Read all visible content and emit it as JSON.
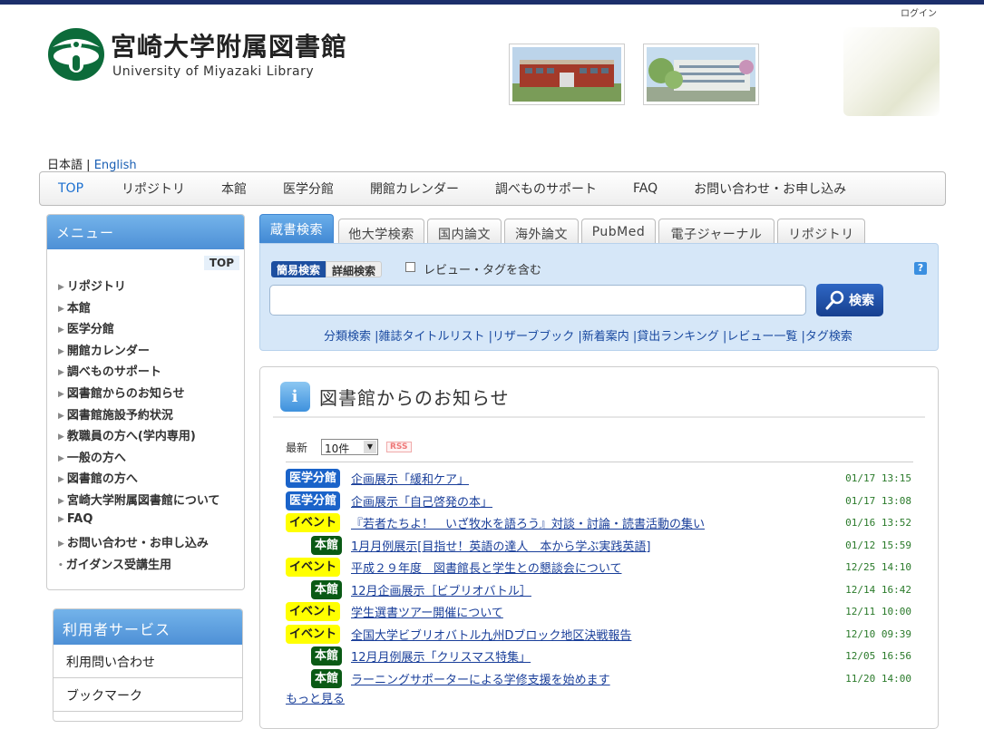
{
  "header": {
    "login": "ログイン",
    "title": "宮崎大学附属図書館",
    "subtitle": "University of Miyazaki Library"
  },
  "lang": {
    "current": "日本語",
    "separator": "|",
    "english": "English"
  },
  "gnav": [
    "TOP",
    "リポジトリ",
    "本館",
    "医学分館",
    "開館カレンダー",
    "調べものサポート",
    "FAQ",
    "お問い合わせ・お申し込み"
  ],
  "sidebar": {
    "title": "メニュー",
    "top_button": "TOP",
    "items": [
      "リポジトリ",
      "本館",
      "医学分館",
      "開館カレンダー",
      "調べものサポート",
      "図書館からのお知らせ",
      "図書館施設予約状況",
      "教職員の方へ(学内専用)",
      "一般の方へ",
      "図書館の方へ",
      "宮崎大学附属図書館について",
      "FAQ",
      "お問い合わせ・お申し込み",
      "ガイダンス受講生用"
    ]
  },
  "services": {
    "title": "利用者サービス",
    "items": [
      "利用問い合わせ",
      "ブックマーク"
    ]
  },
  "search": {
    "tabs": [
      "蔵書検索",
      "他大学検索",
      "国内論文",
      "海外論文",
      "PubMed",
      "電子ジャーナル",
      "リポジトリ"
    ],
    "active_tab": "蔵書検索",
    "mode_simple": "簡易検索",
    "mode_detail": "詳細検索",
    "review_tag_label": "レビュー・タグを含む",
    "help": "?",
    "button": "検索",
    "input_value": "",
    "links": "分類検索 |雑誌タイトルリスト |リザーブブック |新着案内 |貸出ランキング |レビュー一覧 |タグ検索"
  },
  "news": {
    "title": "図書館からのお知らせ",
    "latest_label": "最新",
    "count_selected": "10件",
    "rss": "RSS",
    "more": "もっと見る",
    "items": [
      {
        "tag": "医学分館",
        "type": "med",
        "title": "企画展示「緩和ケア」",
        "date": "01/17 13:15"
      },
      {
        "tag": "医学分館",
        "type": "med",
        "title": "企画展示「自己啓発の本」",
        "date": "01/17 13:08"
      },
      {
        "tag": "イベント",
        "type": "event",
        "title": "『若者たちよ！　いざ牧水を語ろう』対談・討論・読書活動の集い",
        "date": "01/16 13:52"
      },
      {
        "tag": "本館",
        "type": "main",
        "title": "1月月例展示[目指せ！英語の達人　本から学ぶ実践英語]",
        "date": "01/12 15:59"
      },
      {
        "tag": "イベント",
        "type": "event",
        "title": "平成２９年度　図書館長と学生との懇談会について",
        "date": "12/25 14:10"
      },
      {
        "tag": "本館",
        "type": "main",
        "title": "12月企画展示［ビブリオバトル］",
        "date": "12/14 16:42"
      },
      {
        "tag": "イベント",
        "type": "event",
        "title": "学生選書ツアー開催について",
        "date": "12/11 10:00"
      },
      {
        "tag": "イベント",
        "type": "event",
        "title": "全国大学ビブリオバトル九州Dブロック地区決戦報告",
        "date": "12/10 09:39"
      },
      {
        "tag": "本館",
        "type": "main",
        "title": "12月月例展示「クリスマス特集」",
        "date": "12/05 16:56"
      },
      {
        "tag": "本館",
        "type": "main",
        "title": "ラーニングサポーターによる学修支援を始めます",
        "date": "11/20 14:00"
      }
    ]
  }
}
